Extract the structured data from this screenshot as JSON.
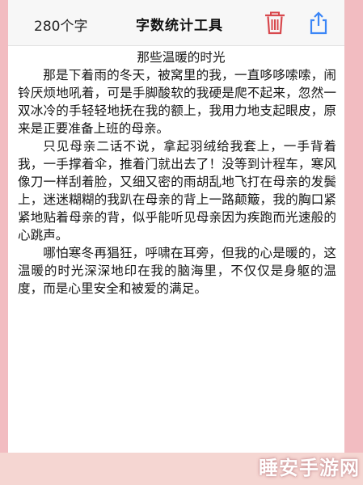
{
  "toolbar": {
    "count_label": "280个字",
    "title": "字数统计工具",
    "delete_icon": "trash-icon",
    "share_icon": "share-icon",
    "accent_color": "#d8484d",
    "share_color": "#3b86f7"
  },
  "document": {
    "title": "那些温暖的时光",
    "paragraphs": [
      "那是下着雨的冬天，被窝里的我，一直哆哆嗦嗦，闹铃厌烦地吼着，可是手脚酸软的我硬是爬不起来，忽然一双冰冷的手轻轻地抚在我的额上，我用力地支起眼皮，原来是正要准备上班的母亲。",
      "只见母亲二话不说，拿起羽绒给我套上，一手背着我，一手撑着伞，推着门就出去了！没等到计程车，寒风像刀一样刮着脸，又细又密的雨胡乱地飞打在母亲的发鬓上，迷迷糊糊的我趴在母亲的背上一路颠簸，我的胸口紧紧地贴着母亲的背，似乎能听见母亲因为疾跑而光速般的心跳声。",
      "哪怕寒冬再猖狂，呼啸在耳旁，但我的心是暖的，这温暖的时光深深地印在我的脑海里，不仅仅是身躯的温度，而是心里安全和被爱的满足。"
    ]
  },
  "watermark": {
    "text": "睡安手游网"
  }
}
